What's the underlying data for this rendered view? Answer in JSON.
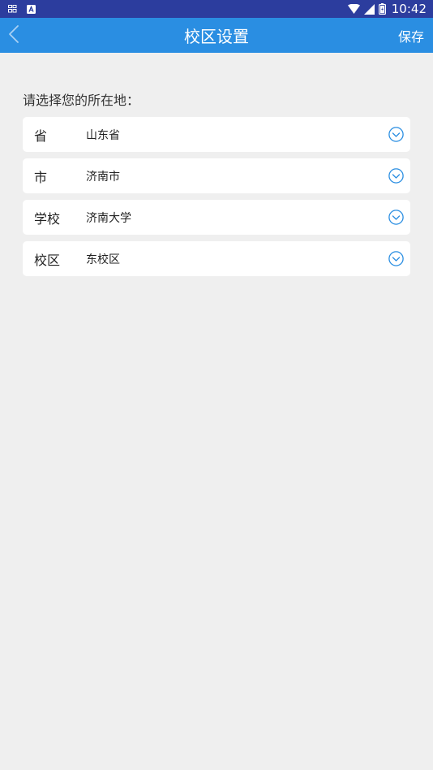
{
  "status_bar": {
    "time": "10:42",
    "icons": [
      "notification-icon",
      "app-icon",
      "wifi-icon",
      "cell-signal-icon",
      "battery-icon"
    ]
  },
  "header": {
    "title": "校区设置",
    "back_icon": "chevron-left-icon",
    "save_label": "保存"
  },
  "main": {
    "prompt": "请选择您的所在地：",
    "rows": [
      {
        "label": "省",
        "value": "山东省",
        "icon": "chevron-down-circle-icon"
      },
      {
        "label": "市",
        "value": "济南市",
        "icon": "chevron-down-circle-icon"
      },
      {
        "label": "学校",
        "value": "济南大学",
        "icon": "chevron-down-circle-icon"
      },
      {
        "label": "校区",
        "value": "东校区",
        "icon": "chevron-down-circle-icon"
      }
    ]
  },
  "colors": {
    "status_bar": "#2c3d9e",
    "app_bar": "#2a8ee2",
    "background": "#efefef",
    "accent": "#2a8ee2"
  }
}
